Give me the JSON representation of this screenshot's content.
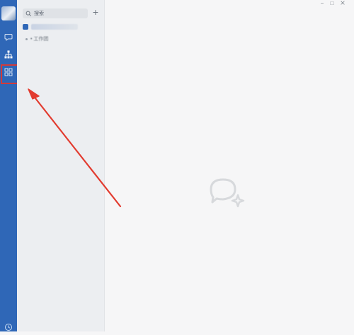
{
  "sidebar": {
    "search_placeholder": "搜索",
    "new_button_label": "+",
    "subitem_label": "• 工作团"
  },
  "window_controls": {
    "minimize": "−",
    "maximize": "□"
  },
  "colors": {
    "rail_blue": "#2f67b7",
    "highlight_red": "#d23a3a",
    "sidebar_bg": "#eceef1",
    "main_bg": "#f6f6f7"
  },
  "icons": {
    "rail": [
      "chat-icon",
      "org-chart-icon",
      "apps-grid-icon"
    ],
    "rail_bottom": "clock-icon",
    "search": "search-icon",
    "empty_state": "chat-logo-icon"
  }
}
